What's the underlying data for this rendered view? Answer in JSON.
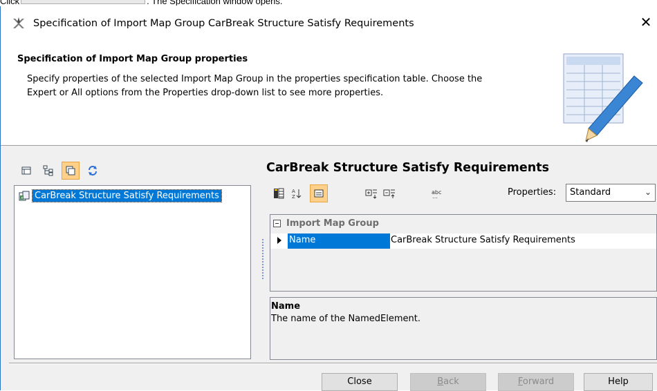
{
  "caption": {
    "before": "Click",
    "after": ". The Specification window opens."
  },
  "window": {
    "title": "Specification of Import Map Group CarBreak Structure Satisfy Requirements"
  },
  "header": {
    "heading": "Specification of Import Map Group properties",
    "line1": "Specify properties of the selected Import Map Group in the properties specification table. Choose the",
    "line2": "Expert or All options from the Properties drop-down list to see more properties."
  },
  "tree": {
    "items": [
      {
        "label": "CarBreak Structure Satisfy Requirements",
        "icon": "import-map-icon"
      }
    ]
  },
  "panel": {
    "title": "CarBreak Structure Satisfy Requirements"
  },
  "properties": {
    "label": "Properties:",
    "selected": "Standard"
  },
  "table": {
    "group": "Import Map Group",
    "rows": [
      {
        "key": "Name",
        "value": "CarBreak Structure Satisfy Requirements"
      }
    ]
  },
  "description": {
    "name": "Name",
    "text": "The name of the NamedElement."
  },
  "buttons": {
    "close": "Close",
    "back_mnemonic": "B",
    "back_rest": "ack",
    "forward_mnemonic": "F",
    "forward_rest": "orward",
    "help": "Help"
  },
  "colors": {
    "accent": "#0078d7",
    "active_toggle": "#ffd089",
    "window_border": "#2b73c7"
  }
}
